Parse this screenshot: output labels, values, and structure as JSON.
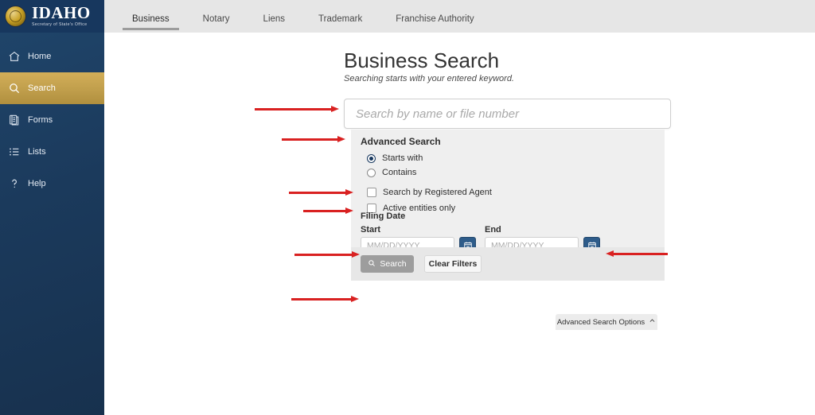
{
  "header": {
    "logo": {
      "seal_icon": "idaho-state-seal-icon",
      "title": "IDAHO",
      "subtitle": "Secretary of State's Office"
    },
    "tabs": [
      {
        "label": "Business",
        "active": true
      },
      {
        "label": "Notary",
        "active": false
      },
      {
        "label": "Liens",
        "active": false
      },
      {
        "label": "Trademark",
        "active": false
      },
      {
        "label": "Franchise Authority",
        "active": false
      }
    ]
  },
  "sidebar": {
    "items": [
      {
        "label": "Home",
        "icon": "home-icon",
        "active": false
      },
      {
        "label": "Search",
        "icon": "search-icon",
        "active": true
      },
      {
        "label": "Forms",
        "icon": "forms-icon",
        "active": false
      },
      {
        "label": "Lists",
        "icon": "lists-icon",
        "active": false
      },
      {
        "label": "Help",
        "icon": "help-icon",
        "active": false
      }
    ]
  },
  "main": {
    "title": "Business Search",
    "subtitle": "Searching starts with your entered keyword.",
    "search": {
      "placeholder": "Search by name or file number",
      "value": ""
    },
    "advanced": {
      "title": "Advanced Search",
      "match_options": [
        {
          "label": "Starts with",
          "selected": true
        },
        {
          "label": "Contains",
          "selected": false
        }
      ],
      "checkboxes": [
        {
          "label": "Search by Registered Agent",
          "checked": false
        },
        {
          "label": "Active entities only",
          "checked": false
        }
      ],
      "filing_date": {
        "group_label": "Filing Date",
        "start_label": "Start",
        "start_placeholder": "MM/DD/YYYY",
        "start_value": "",
        "end_label": "End",
        "end_placeholder": "MM/DD/YYYY",
        "end_value": "",
        "calendar_icon": "calendar-icon"
      },
      "search_button": "Search",
      "search_button_icon": "search-icon",
      "clear_button": "Clear Filters",
      "options_toggle": "Advanced Search Options",
      "options_toggle_icon": "chevron-up-icon"
    }
  },
  "annotations": {
    "arrows": [
      {
        "target": "search-input",
        "direction": "right"
      },
      {
        "target": "advanced-search-title",
        "direction": "right"
      },
      {
        "target": "registered-agent-checkbox",
        "direction": "right"
      },
      {
        "target": "active-entities-checkbox",
        "direction": "right"
      },
      {
        "target": "start-date-field",
        "direction": "right"
      },
      {
        "target": "end-date-calendar-button",
        "direction": "left"
      },
      {
        "target": "search-button",
        "direction": "right"
      }
    ],
    "color": "#d92121"
  }
}
